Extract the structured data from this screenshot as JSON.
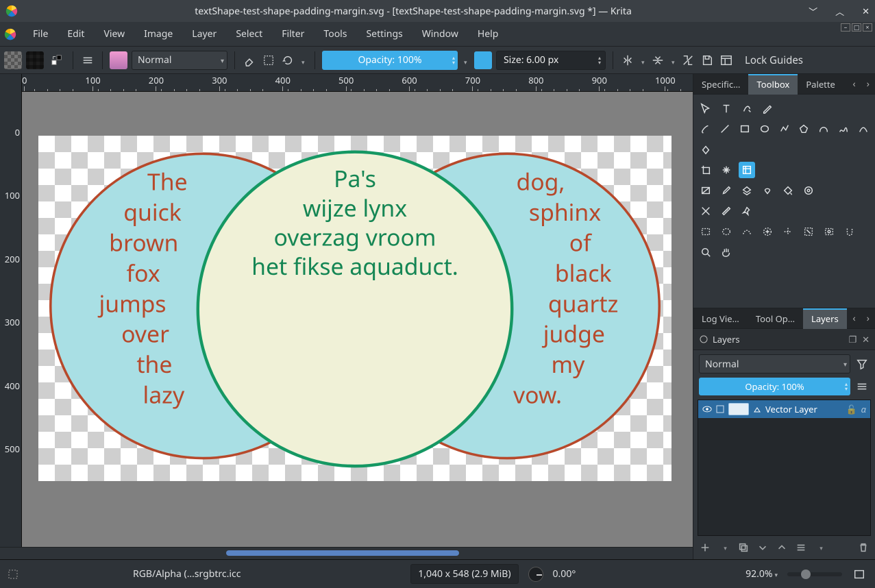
{
  "window": {
    "title": "textShape-test-shape-padding-margin.svg - [textShape-test-shape-padding-margin.svg *] — Krita"
  },
  "menu": [
    "File",
    "Edit",
    "View",
    "Image",
    "Layer",
    "Select",
    "Filter",
    "Tools",
    "Settings",
    "Window",
    "Help"
  ],
  "toolbar": {
    "blend_mode": "Normal",
    "opacity_label": "Opacity: 100%",
    "size_label": "Size: 6.00 px",
    "lock_guides": "Lock Guides"
  },
  "ruler_h": [
    "0",
    "100",
    "200",
    "300",
    "400",
    "500",
    "600",
    "700",
    "800",
    "900",
    "1000"
  ],
  "ruler_v": [
    "0",
    "100",
    "200",
    "300",
    "400",
    "500"
  ],
  "right_tabs_top": {
    "specific": "Specific…",
    "toolbox": "Toolbox",
    "palette": "Palette"
  },
  "right_tabs_mid": {
    "logview": "Log Vie…",
    "toolopts": "Tool Op…",
    "layers": "Layers"
  },
  "toolbox": {
    "tools": [
      [
        "move",
        "text",
        "calligraphy",
        "edit"
      ],
      [
        "brush",
        "line",
        "rect",
        "ellipse",
        "polyline",
        "polygon",
        "bezier",
        "freehand",
        "dynamic"
      ],
      [
        "transform"
      ],
      [
        "crop",
        "pan",
        "crop2"
      ],
      [
        "grad",
        "picker",
        "pattern",
        "smart",
        "fill",
        "assist"
      ],
      [
        "deform",
        "measure",
        "pin"
      ],
      [
        "sel-rect",
        "sel-ell",
        "sel-outline",
        "sel-contig",
        "sel-color",
        "sel-bezier",
        "sel-similar",
        "sel-magnetic"
      ],
      [
        "zoom",
        "hand"
      ]
    ]
  },
  "layers_panel": {
    "header": "Layers",
    "blend": "Normal",
    "opacity": "Opacity:  100%",
    "layer_name": "Vector Layer"
  },
  "status": {
    "profile": "RGB/Alpha (…srgbtrc.icc",
    "dims": "1,040 x 548 (2.9 MiB)",
    "rotation": "0.00°",
    "zoom": "92.0%"
  },
  "canvas": {
    "left_text": [
      "The",
      "quick",
      "brown",
      "fox",
      "jumps",
      "over",
      "the",
      "lazy"
    ],
    "center_text": [
      "Pa's",
      "wijze lynx",
      "overzag vroom",
      "het fikse aquaduct."
    ],
    "right_text": [
      "dog,",
      "sphinx",
      "of",
      "black",
      "quartz",
      "judge",
      "my",
      "vow."
    ]
  }
}
